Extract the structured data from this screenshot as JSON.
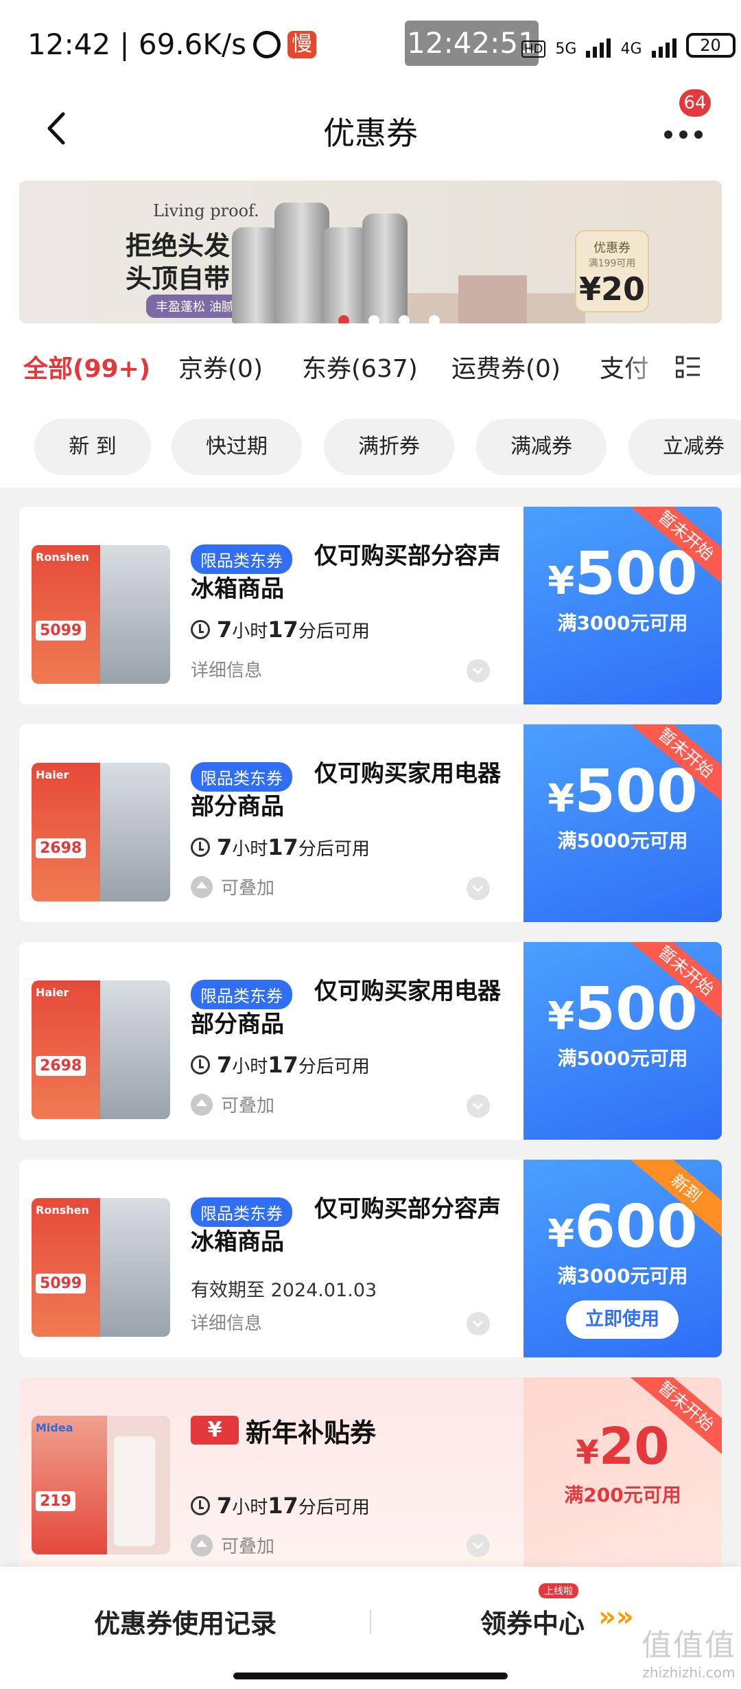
{
  "status_bar": {
    "time_net": "12:42 | 69.6K/s",
    "slow_badge": "慢",
    "clock_overlay": "12:42:51",
    "hd": "HD",
    "net_5g": "5G",
    "net_4g": "4G",
    "battery": "20"
  },
  "header": {
    "title": "优惠券",
    "message_count": "64"
  },
  "banner": {
    "brand": "Living proof.",
    "line1": "拒绝头发“躺平”",
    "line2": "头顶自带“光环”",
    "tag": "丰盈蓬松 油腻塌必囤",
    "ticket_title": "优惠券",
    "ticket_cond": "满199可用",
    "ticket_amount": "¥20",
    "active_dot": 1,
    "dot_count": 4
  },
  "tabs": [
    {
      "label": "全部(99+)",
      "active": true
    },
    {
      "label": "京券(0)",
      "active": false
    },
    {
      "label": "东券(637)",
      "active": false
    },
    {
      "label": "运费券(0)",
      "active": false
    },
    {
      "label": "支付",
      "active": false
    }
  ],
  "filters": [
    "新 到",
    "快过期",
    "满折券",
    "满减券",
    "立减券"
  ],
  "coupons": [
    {
      "badge": "限品类东券",
      "title": "仅可购买部分容声冰箱商品",
      "hours": "7",
      "mins": "17",
      "time_text_h": "小时",
      "time_text_m": "分后可用",
      "footer": "详细信息",
      "currency": "¥",
      "amount": "500",
      "condition": "满3000元可用",
      "ribbon": "暂未开始",
      "product_price": "5099",
      "product_brand": "Ronshen"
    },
    {
      "badge": "限品类东券",
      "title": "仅可购买家用电器部分商品",
      "hours": "7",
      "mins": "17",
      "time_text_h": "小时",
      "time_text_m": "分后可用",
      "footer": "可叠加",
      "currency": "¥",
      "amount": "500",
      "condition": "满5000元可用",
      "ribbon": "暂未开始",
      "product_price": "2698",
      "product_brand": "Haier"
    },
    {
      "badge": "限品类东券",
      "title": "仅可购买家用电器部分商品",
      "hours": "7",
      "mins": "17",
      "time_text_h": "小时",
      "time_text_m": "分后可用",
      "footer": "可叠加",
      "currency": "¥",
      "amount": "500",
      "condition": "满5000元可用",
      "ribbon": "暂未开始",
      "product_price": "2698",
      "product_brand": "Haier"
    },
    {
      "badge": "限品类东券",
      "title": "仅可购买部分容声冰箱商品",
      "expiry": "有效期至 2024.01.03",
      "footer": "详细信息",
      "currency": "¥",
      "amount": "600",
      "condition": "满3000元可用",
      "ribbon": "新到",
      "button": "立即使用",
      "product_price": "5099",
      "product_brand": "Ronshen"
    },
    {
      "icon_text": "¥",
      "title": "新年补贴券",
      "hours": "7",
      "mins": "17",
      "time_text_h": "小时",
      "time_text_m": "分后可用",
      "footer": "可叠加",
      "currency": "¥",
      "amount": "20",
      "condition": "满200元可用",
      "ribbon": "暂未开始",
      "product_price": "219",
      "product_brand": "Midea"
    }
  ],
  "bottom_bar": {
    "left_label": "优惠券使用记录",
    "right_label": "领券中心",
    "right_badge": "上线啦",
    "arrows": "»»"
  },
  "watermark": {
    "big": "值值值",
    "small": "zhizhizhi.com"
  },
  "colors": {
    "accent_red": "#e4393c",
    "coupon_blue": "#2f6ef5",
    "ribbon_orange": "#ff8f24"
  }
}
